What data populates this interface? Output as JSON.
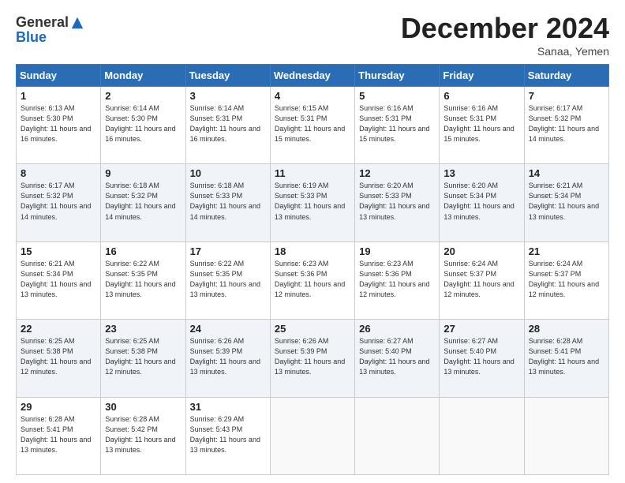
{
  "header": {
    "logo_general": "General",
    "logo_blue": "Blue",
    "month_title": "December 2024",
    "subtitle": "Sanaa, Yemen"
  },
  "days_of_week": [
    "Sunday",
    "Monday",
    "Tuesday",
    "Wednesday",
    "Thursday",
    "Friday",
    "Saturday"
  ],
  "weeks": [
    [
      {
        "day": "1",
        "info": "Sunrise: 6:13 AM\nSunset: 5:30 PM\nDaylight: 11 hours and 16 minutes."
      },
      {
        "day": "2",
        "info": "Sunrise: 6:14 AM\nSunset: 5:30 PM\nDaylight: 11 hours and 16 minutes."
      },
      {
        "day": "3",
        "info": "Sunrise: 6:14 AM\nSunset: 5:31 PM\nDaylight: 11 hours and 16 minutes."
      },
      {
        "day": "4",
        "info": "Sunrise: 6:15 AM\nSunset: 5:31 PM\nDaylight: 11 hours and 15 minutes."
      },
      {
        "day": "5",
        "info": "Sunrise: 6:16 AM\nSunset: 5:31 PM\nDaylight: 11 hours and 15 minutes."
      },
      {
        "day": "6",
        "info": "Sunrise: 6:16 AM\nSunset: 5:31 PM\nDaylight: 11 hours and 15 minutes."
      },
      {
        "day": "7",
        "info": "Sunrise: 6:17 AM\nSunset: 5:32 PM\nDaylight: 11 hours and 14 minutes."
      }
    ],
    [
      {
        "day": "8",
        "info": "Sunrise: 6:17 AM\nSunset: 5:32 PM\nDaylight: 11 hours and 14 minutes."
      },
      {
        "day": "9",
        "info": "Sunrise: 6:18 AM\nSunset: 5:32 PM\nDaylight: 11 hours and 14 minutes."
      },
      {
        "day": "10",
        "info": "Sunrise: 6:18 AM\nSunset: 5:33 PM\nDaylight: 11 hours and 14 minutes."
      },
      {
        "day": "11",
        "info": "Sunrise: 6:19 AM\nSunset: 5:33 PM\nDaylight: 11 hours and 13 minutes."
      },
      {
        "day": "12",
        "info": "Sunrise: 6:20 AM\nSunset: 5:33 PM\nDaylight: 11 hours and 13 minutes."
      },
      {
        "day": "13",
        "info": "Sunrise: 6:20 AM\nSunset: 5:34 PM\nDaylight: 11 hours and 13 minutes."
      },
      {
        "day": "14",
        "info": "Sunrise: 6:21 AM\nSunset: 5:34 PM\nDaylight: 11 hours and 13 minutes."
      }
    ],
    [
      {
        "day": "15",
        "info": "Sunrise: 6:21 AM\nSunset: 5:34 PM\nDaylight: 11 hours and 13 minutes."
      },
      {
        "day": "16",
        "info": "Sunrise: 6:22 AM\nSunset: 5:35 PM\nDaylight: 11 hours and 13 minutes."
      },
      {
        "day": "17",
        "info": "Sunrise: 6:22 AM\nSunset: 5:35 PM\nDaylight: 11 hours and 13 minutes."
      },
      {
        "day": "18",
        "info": "Sunrise: 6:23 AM\nSunset: 5:36 PM\nDaylight: 11 hours and 12 minutes."
      },
      {
        "day": "19",
        "info": "Sunrise: 6:23 AM\nSunset: 5:36 PM\nDaylight: 11 hours and 12 minutes."
      },
      {
        "day": "20",
        "info": "Sunrise: 6:24 AM\nSunset: 5:37 PM\nDaylight: 11 hours and 12 minutes."
      },
      {
        "day": "21",
        "info": "Sunrise: 6:24 AM\nSunset: 5:37 PM\nDaylight: 11 hours and 12 minutes."
      }
    ],
    [
      {
        "day": "22",
        "info": "Sunrise: 6:25 AM\nSunset: 5:38 PM\nDaylight: 11 hours and 12 minutes."
      },
      {
        "day": "23",
        "info": "Sunrise: 6:25 AM\nSunset: 5:38 PM\nDaylight: 11 hours and 12 minutes."
      },
      {
        "day": "24",
        "info": "Sunrise: 6:26 AM\nSunset: 5:39 PM\nDaylight: 11 hours and 13 minutes."
      },
      {
        "day": "25",
        "info": "Sunrise: 6:26 AM\nSunset: 5:39 PM\nDaylight: 11 hours and 13 minutes."
      },
      {
        "day": "26",
        "info": "Sunrise: 6:27 AM\nSunset: 5:40 PM\nDaylight: 11 hours and 13 minutes."
      },
      {
        "day": "27",
        "info": "Sunrise: 6:27 AM\nSunset: 5:40 PM\nDaylight: 11 hours and 13 minutes."
      },
      {
        "day": "28",
        "info": "Sunrise: 6:28 AM\nSunset: 5:41 PM\nDaylight: 11 hours and 13 minutes."
      }
    ],
    [
      {
        "day": "29",
        "info": "Sunrise: 6:28 AM\nSunset: 5:41 PM\nDaylight: 11 hours and 13 minutes."
      },
      {
        "day": "30",
        "info": "Sunrise: 6:28 AM\nSunset: 5:42 PM\nDaylight: 11 hours and 13 minutes."
      },
      {
        "day": "31",
        "info": "Sunrise: 6:29 AM\nSunset: 5:43 PM\nDaylight: 11 hours and 13 minutes."
      },
      null,
      null,
      null,
      null
    ]
  ]
}
